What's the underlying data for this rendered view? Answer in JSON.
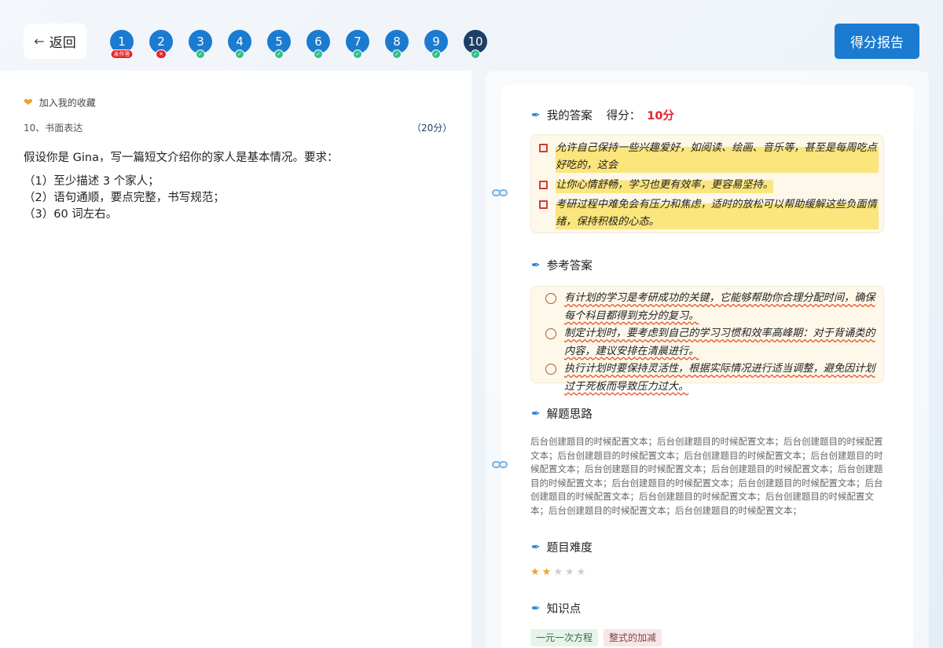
{
  "topbar": {
    "back_icon": "←",
    "back_label": "返回",
    "report_label": "得分报告",
    "questions": [
      {
        "num": "1",
        "badge": "未作答",
        "badge_type": "red",
        "current": false
      },
      {
        "num": "2",
        "badge": "✕",
        "badge_type": "red",
        "current": false
      },
      {
        "num": "3",
        "badge": "✓",
        "badge_type": "green",
        "current": false
      },
      {
        "num": "4",
        "badge": "✓",
        "badge_type": "green",
        "current": false
      },
      {
        "num": "5",
        "badge": "✓",
        "badge_type": "green",
        "current": false
      },
      {
        "num": "6",
        "badge": "✓",
        "badge_type": "green",
        "current": false
      },
      {
        "num": "7",
        "badge": "✓",
        "badge_type": "green",
        "current": false
      },
      {
        "num": "8",
        "badge": "✓",
        "badge_type": "green",
        "current": false
      },
      {
        "num": "9",
        "badge": "✓",
        "badge_type": "green",
        "current": false
      },
      {
        "num": "10",
        "badge": "✓",
        "badge_type": "green",
        "current": true
      }
    ]
  },
  "question": {
    "favorite_label": "加入我的收藏",
    "title": "10、书面表达",
    "score": "（20分）",
    "prompt": "假设你是 Gina，写一篇短文介绍你的家人是基本情况。要求：",
    "requirements": [
      "（1）至少描述 3 个家人；",
      "（2）语句通顺，要点完整，书写规范；",
      "（3）60 词左右。"
    ]
  },
  "my_answer": {
    "title": "我的答案",
    "score_label": "得分：",
    "score_value": "10分",
    "lines": [
      "允许自己保持一些兴趣爱好，如阅读、绘画、音乐等，甚至是每周吃点好吃的，这会",
      "让你心情舒畅，学习也更有效率，更容易坚持。",
      "考研过程中难免会有压力和焦虑，适时的放松可以帮助缓解这些负面情绪，保持积极的心态。"
    ]
  },
  "reference": {
    "title": "参考答案",
    "lines": [
      "有计划的学习是考研成功的关键，它能够帮助你合理分配时间，确保每个科目都得到充分的复习。",
      "制定计划时，要考虑到自己的学习习惯和效率高峰期：对于背诵类的内容，建议安排在清晨进行。",
      "执行计划时要保持灵活性，根据实际情况进行适当调整，避免因计划过于死板而导致压力过大。"
    ]
  },
  "analysis": {
    "title": "解题思路",
    "text": "后台创建题目的时候配置文本；后台创建题目的时候配置文本；后台创建题目的时候配置文本；后台创建题目的时候配置文本；后台创建题目的时候配置文本；后台创建题目的时候配置文本；后台创建题目的时候配置文本；后台创建题目的时候配置文本；后台创建题目的时候配置文本；后台创建题目的时候配置文本；后台创建题目的时候配置文本；后台创建题目的时候配置文本；后台创建题目的时候配置文本；后台创建题目的时候配置文本；后台创建题目的时候配置文本；后台创建题目的时候配置文本；"
  },
  "difficulty": {
    "title": "题目难度",
    "level": 2,
    "max": 5
  },
  "knowledge": {
    "title": "知识点",
    "tags": [
      "一元一次方程",
      "整式的加减"
    ]
  },
  "colors": {
    "primary": "#1b7bd0",
    "current_question": "#1d3f66",
    "error": "#e5252a",
    "correct": "#2fbf8f",
    "star": "#f0a12b"
  }
}
